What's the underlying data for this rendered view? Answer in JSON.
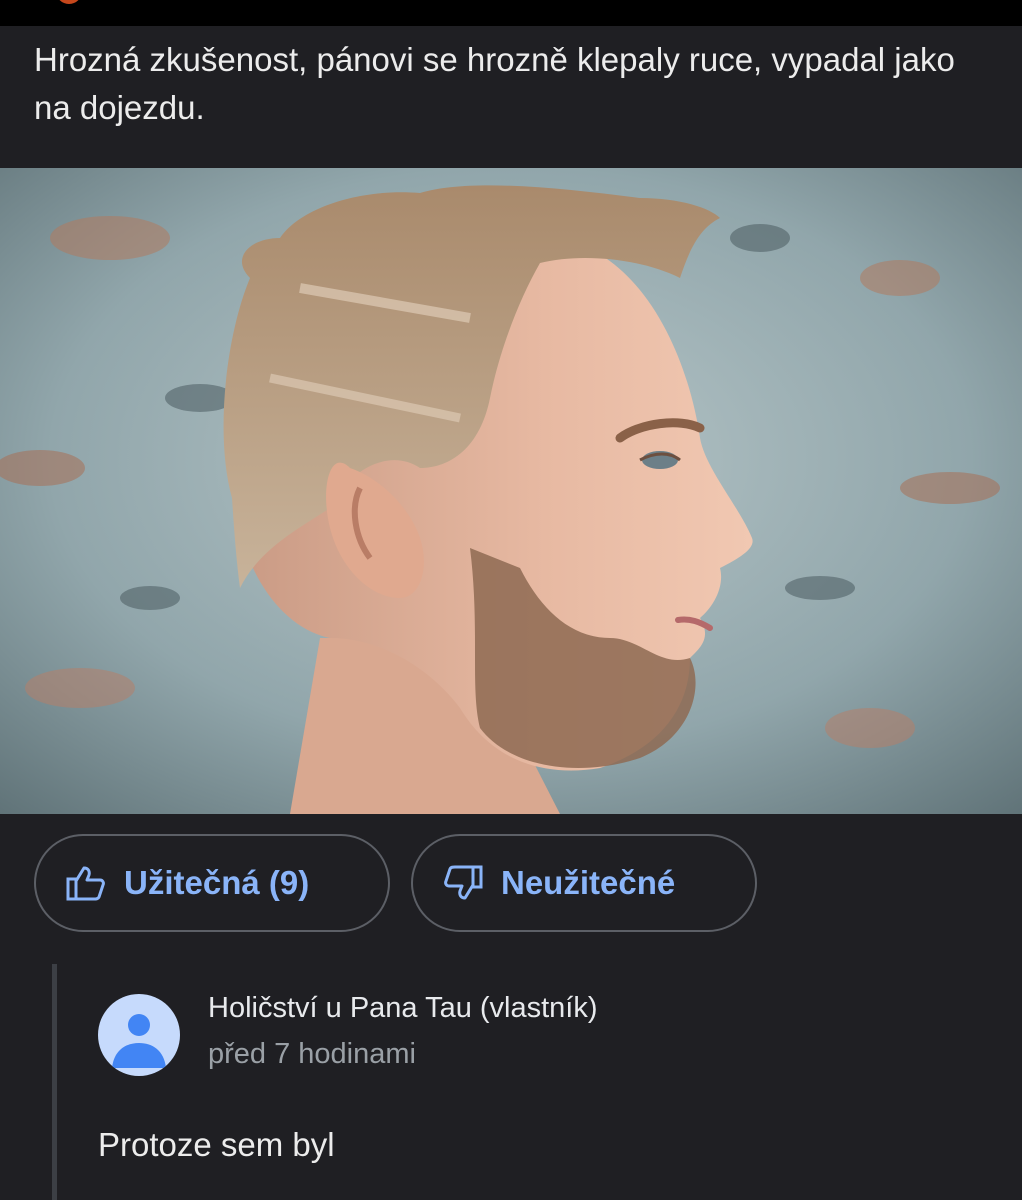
{
  "review": {
    "text": "Hrozná zkušenost, pánovi se hrozně klepaly ruce, vypadal jako na dojezdu."
  },
  "photo": {
    "icon": "review-photo-man-profile-haircut"
  },
  "actions": {
    "helpful_label": "Užitečná (9)",
    "helpful_icon": "thumbs-up-icon",
    "unhelpful_label": "Neužitečné",
    "unhelpful_icon": "thumbs-down-icon",
    "accent_color": "#8ab4f8"
  },
  "owner_reply": {
    "author": "Holičství u Pana Tau (vlastník)",
    "time": "před 7 hodinami",
    "text": "Protoze sem byl",
    "avatar_icon": "default-profile-icon",
    "avatar_color": "#c6dafc"
  }
}
